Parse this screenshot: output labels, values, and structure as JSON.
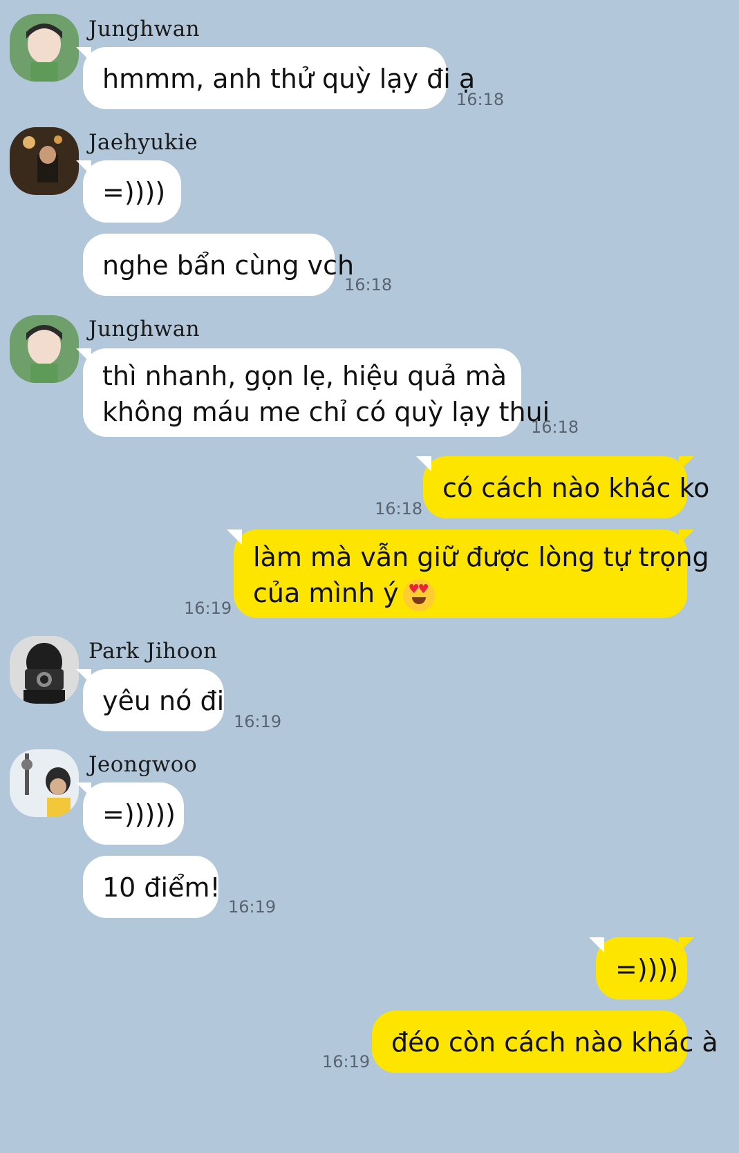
{
  "messages": [
    {
      "sender": "Junghwan",
      "lines": [
        "hmmm, anh thử quỳ lạy đi ạ"
      ],
      "time": "16:18"
    },
    {
      "sender": "Jaehyukie",
      "lines": [
        "=))))"
      ]
    },
    {
      "lines": [
        "nghe bẩn cùng vch"
      ],
      "time": "16:18"
    },
    {
      "sender": "Junghwan",
      "lines": [
        "thì nhanh, gọn lẹ, hiệu quả mà",
        "không máu me chỉ có quỳ lạy thui"
      ],
      "time": "16:18"
    },
    {
      "me": true,
      "lines": [
        "có cách nào khác ko"
      ],
      "time": "16:18"
    },
    {
      "me": true,
      "lines": [
        "làm mà vẫn giữ được lòng tự trọng",
        "của mình ý"
      ],
      "emoji": "heart-eyes-emoji",
      "time": "16:19"
    },
    {
      "sender": "Park Jihoon",
      "lines": [
        "yêu nó đi"
      ],
      "time": "16:19"
    },
    {
      "sender": "Jeongwoo",
      "lines": [
        "=)))))"
      ]
    },
    {
      "lines": [
        "10 điểm!"
      ],
      "time": "16:19"
    },
    {
      "me": true,
      "lines": [
        "=))))"
      ]
    },
    {
      "me": true,
      "lines": [
        "đéo còn cách nào khác à"
      ],
      "time": "16:19"
    }
  ],
  "colors": {
    "background": "#b2c7da",
    "incoming": "#ffffff",
    "outgoing": "#fee500"
  }
}
